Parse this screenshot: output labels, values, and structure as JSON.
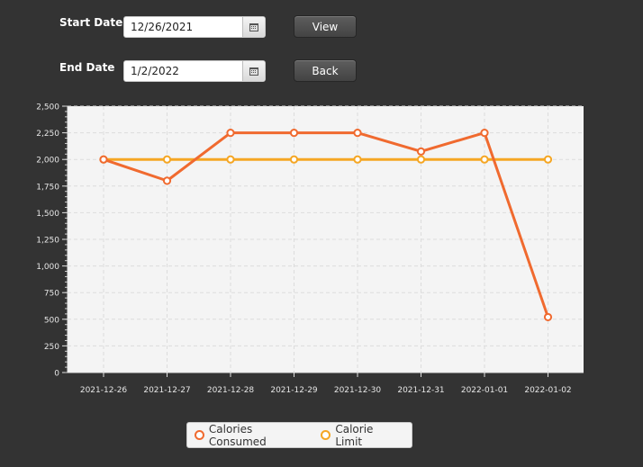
{
  "form": {
    "start_label": "Start Date",
    "start_value": "12/26/2021",
    "end_label": "End Date",
    "end_value": "1/2/2022",
    "view_label": "View",
    "back_label": "Back"
  },
  "chart_data": {
    "type": "line",
    "x": [
      "2021-12-26",
      "2021-12-27",
      "2021-12-28",
      "2021-12-29",
      "2021-12-30",
      "2021-12-31",
      "2022-01-01",
      "2022-01-02"
    ],
    "series": [
      {
        "name": "Calories Consumed",
        "color": "#f06a2f",
        "values": [
          2000,
          1800,
          2250,
          2250,
          2250,
          2075,
          2250,
          520
        ]
      },
      {
        "name": "Calorie Limit",
        "color": "#f5a623",
        "values": [
          2000,
          2000,
          2000,
          2000,
          2000,
          2000,
          2000,
          2000
        ]
      }
    ],
    "yticks": [
      "0",
      "250",
      "500",
      "750",
      "1,000",
      "1,250",
      "1,500",
      "1,750",
      "2,000",
      "2,250",
      "2,500"
    ],
    "ylim": [
      0,
      2500
    ],
    "grid": true,
    "legend_position": "bottom"
  }
}
